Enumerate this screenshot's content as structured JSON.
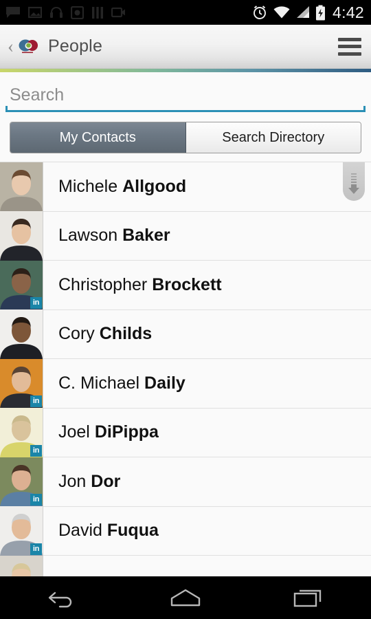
{
  "status_bar": {
    "time": "4:42",
    "left_icons": [
      "message-icon",
      "screenshot-icon",
      "headphones-icon",
      "photo-app-icon",
      "library-icon",
      "video-icon"
    ],
    "right_icons": [
      "alarm-icon",
      "wifi-icon",
      "signal-icon",
      "battery-charging-icon"
    ]
  },
  "action_bar": {
    "back_label": "‹",
    "logo_name": "app-logo-circles",
    "title": "People",
    "menu_name": "hamburger-menu"
  },
  "search": {
    "value": "",
    "placeholder": "Search"
  },
  "tabs": [
    {
      "label": "My Contacts",
      "active": true
    },
    {
      "label": "Search Directory",
      "active": false
    }
  ],
  "contacts": [
    {
      "first": "Michele",
      "last": "Allgood",
      "linkedin": false
    },
    {
      "first": "Lawson",
      "last": "Baker",
      "linkedin": false
    },
    {
      "first": "Christopher",
      "last": "Brockett",
      "linkedin": true
    },
    {
      "first": "Cory",
      "last": "Childs",
      "linkedin": false
    },
    {
      "first": "C. Michael",
      "last": "Daily",
      "linkedin": true
    },
    {
      "first": "Joel",
      "last": "DiPippa",
      "linkedin": true
    },
    {
      "first": "Jon",
      "last": "Dor",
      "linkedin": true
    },
    {
      "first": "David",
      "last": "Fuqua",
      "linkedin": true
    },
    {
      "first": "",
      "last": "",
      "linkedin": false
    }
  ],
  "linkedin_badge_label": "in",
  "scroll_indicator": "scroll-down-thumb",
  "nav_bar": {
    "back": "back-button",
    "home": "home-button",
    "recents": "recents-button"
  },
  "colors": {
    "accent_blue": "#2a8fb5",
    "tab_active_bg": "#6c7884",
    "linkedin": "#1a85a8",
    "status_bg": "#000000"
  }
}
